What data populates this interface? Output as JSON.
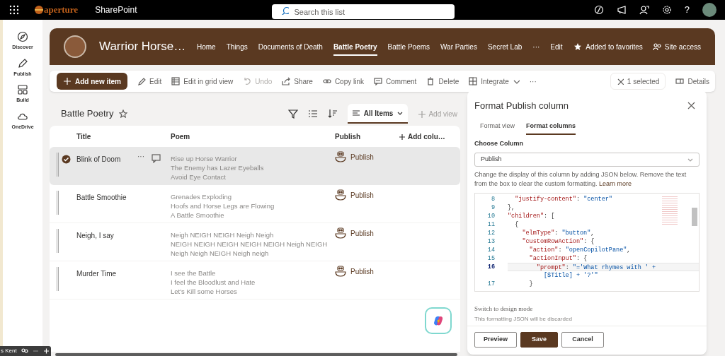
{
  "app_bar": {
    "brand": "aperture",
    "app_name": "SharePoint",
    "search": {
      "placeholder": "Search this list"
    },
    "help": "?"
  },
  "left_rail": [
    {
      "label": "Discover"
    },
    {
      "label": "Publish"
    },
    {
      "label": "Build"
    },
    {
      "label": "OneDrive"
    }
  ],
  "site": {
    "title": "Warrior Horse…",
    "nav": [
      {
        "label": "Home",
        "selected": false
      },
      {
        "label": "Things",
        "selected": false
      },
      {
        "label": "Documents of Death",
        "selected": false
      },
      {
        "label": "Battle Poetry",
        "selected": true
      },
      {
        "label": "Battle Poems",
        "selected": false
      },
      {
        "label": "War Parties",
        "selected": false
      },
      {
        "label": "Secret Lab",
        "selected": false
      },
      {
        "label": "···",
        "selected": false
      },
      {
        "label": "Edit",
        "selected": false
      }
    ],
    "favorite": "Added to favorites",
    "site_access": "Site access"
  },
  "command_bar": {
    "items": [
      {
        "label": "Add new item",
        "kind": "primary"
      },
      {
        "label": "Edit",
        "kind": "normal"
      },
      {
        "label": "Edit in grid view",
        "kind": "normal"
      },
      {
        "label": "Undo",
        "kind": "disabled"
      },
      {
        "label": "Share",
        "kind": "normal"
      },
      {
        "label": "Copy link",
        "kind": "normal"
      },
      {
        "label": "Comment",
        "kind": "normal"
      },
      {
        "label": "Delete",
        "kind": "normal"
      },
      {
        "label": "Integrate",
        "kind": "dropdown"
      },
      {
        "label": "···",
        "kind": "more"
      }
    ],
    "selection": "1 selected",
    "details": "Details"
  },
  "list": {
    "title": "Battle Poetry",
    "view": "All Items",
    "add_view": "Add view",
    "columns": [
      "Title",
      "Poem",
      "Publish",
      "Add colu…"
    ],
    "rows": [
      {
        "title": "Blink of Doom",
        "poem": [
          "Rise up Horse Warrior",
          "The Enemy has Lazer Eyeballs",
          "Avoid Eye Contact"
        ],
        "publish": "Publish",
        "more": "···",
        "selected": true
      },
      {
        "title": "Battle Smoothie",
        "poem": [
          "Grenades Exploding",
          "Hoofs and Horse Legs are Flowing",
          "A Battle Smoothie"
        ],
        "publish": "Publish",
        "selected": false
      },
      {
        "title": "Neigh, I say",
        "poem": [
          "Neigh NEIGH NEIGH Neigh Neigh",
          "NEIGH NEIGH NEIGH NEIGH NEIGH Neigh NEIGH",
          "Neigh Neigh NEIGH Neigh neigh"
        ],
        "publish": "Publish",
        "selected": false
      },
      {
        "title": "Murder Time",
        "poem": [
          "I see the Battle",
          "I feel the Bloodlust and Hate",
          "Let's Kill some Horses"
        ],
        "publish": "Publish",
        "selected": false
      }
    ]
  },
  "panel": {
    "title": "Format Publish column",
    "tabs": [
      {
        "label": "Format view",
        "selected": false
      },
      {
        "label": "Format columns",
        "selected": true
      }
    ],
    "choose_label": "Choose Column",
    "column_value": "Publish",
    "description": "Change the display of this column by adding JSON below. Remove the text from the box to clear the custom formatting.",
    "learn_more": "Learn more",
    "code": [
      {
        "number": "8",
        "current": false,
        "tokens": [
          {
            "text": "  \"justify-content\"",
            "kind": "key"
          },
          {
            "text": ": ",
            "kind": "punct"
          },
          {
            "text": "\"center\"",
            "kind": "string"
          }
        ]
      },
      {
        "number": "9",
        "current": false,
        "tokens": [
          {
            "text": "},",
            "kind": "punct"
          }
        ]
      },
      {
        "number": "10",
        "current": false,
        "tokens": [
          {
            "text": "\"children\"",
            "kind": "key"
          },
          {
            "text": ": [",
            "kind": "punct"
          }
        ]
      },
      {
        "number": "11",
        "current": false,
        "tokens": [
          {
            "text": "  {",
            "kind": "punct"
          }
        ]
      },
      {
        "number": "12",
        "current": false,
        "tokens": [
          {
            "text": "    \"elmType\"",
            "kind": "key"
          },
          {
            "text": ": ",
            "kind": "punct"
          },
          {
            "text": "\"button\"",
            "kind": "string"
          },
          {
            "text": ",",
            "kind": "punct"
          }
        ]
      },
      {
        "number": "13",
        "current": false,
        "tokens": [
          {
            "text": "    \"customRowAction\"",
            "kind": "key"
          },
          {
            "text": ": {",
            "kind": "punct"
          }
        ]
      },
      {
        "number": "14",
        "current": false,
        "tokens": [
          {
            "text": "      \"action\"",
            "kind": "key"
          },
          {
            "text": ": ",
            "kind": "punct"
          },
          {
            "text": "\"openCopilotPane\"",
            "kind": "string"
          },
          {
            "text": ",",
            "kind": "punct"
          }
        ]
      },
      {
        "number": "15",
        "current": false,
        "tokens": [
          {
            "text": "      \"actionInput\"",
            "kind": "key"
          },
          {
            "text": ": {",
            "kind": "punct"
          }
        ]
      },
      {
        "number": "16",
        "current": true,
        "tokens": [
          {
            "text": "        \"prompt\"",
            "kind": "key"
          },
          {
            "text": ": ",
            "kind": "punct"
          },
          {
            "text": "\"='What rhymes with ' +",
            "kind": "string"
          }
        ]
      },
      {
        "current": false,
        "tokens": [
          {
            "text": "          [$Title] + '?'\"",
            "kind": "string"
          }
        ]
      },
      {
        "number": "17",
        "current": false,
        "tokens": [
          {
            "text": "      }",
            "kind": "punct"
          }
        ]
      }
    ],
    "design_mode": "Switch to design mode",
    "design_note": "This formatting JSON will be discarded",
    "buttons": [
      {
        "label": "Preview",
        "kind": "secondary"
      },
      {
        "label": "Save",
        "kind": "primary"
      },
      {
        "label": "Cancel",
        "kind": "secondary"
      }
    ]
  },
  "presence": "s Kent"
}
